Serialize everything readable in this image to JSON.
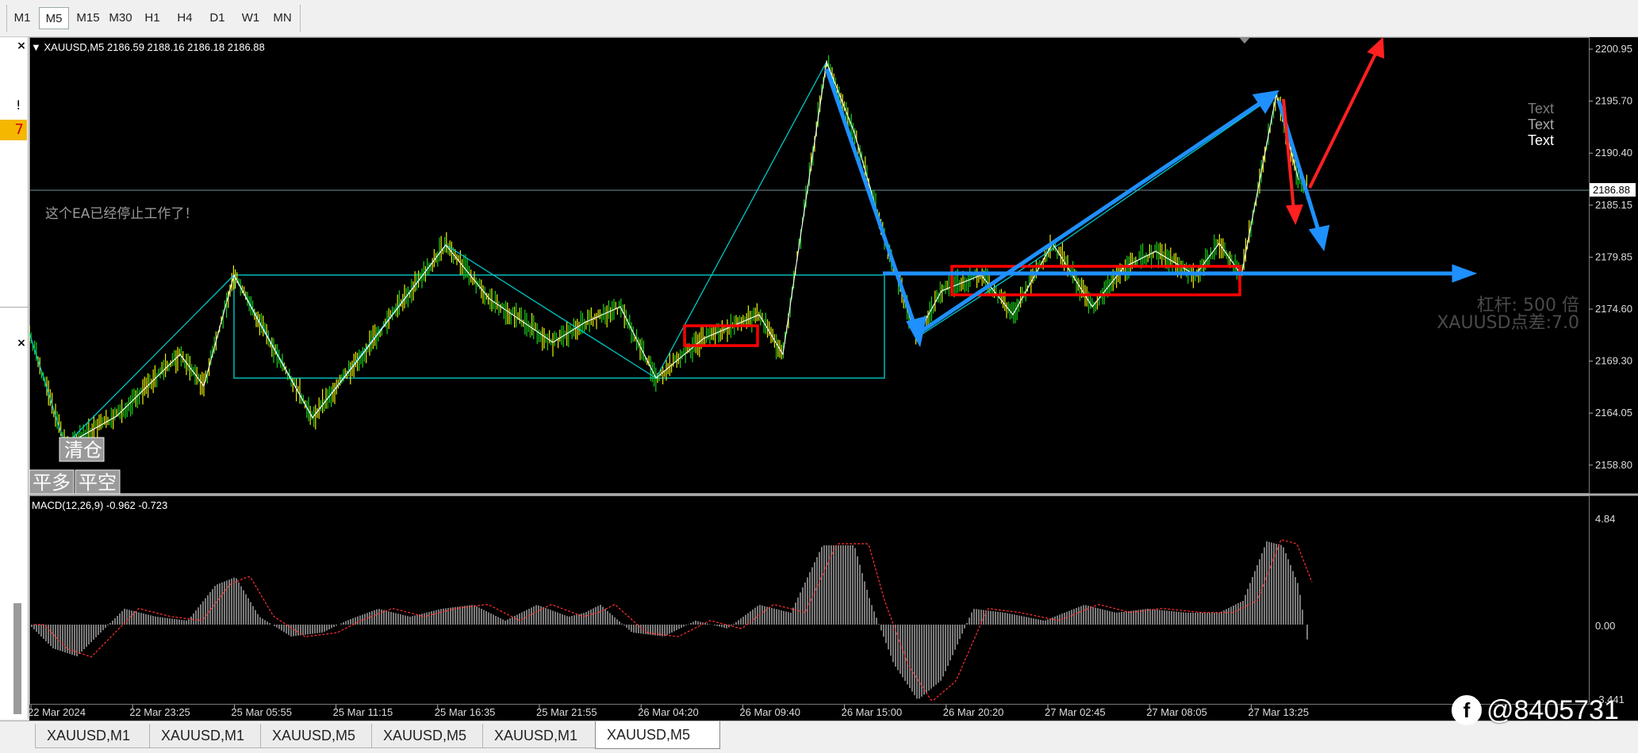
{
  "toolbar": {
    "timeframes": [
      "M1",
      "M5",
      "M15",
      "M30",
      "H1",
      "H4",
      "D1",
      "W1",
      "MN"
    ],
    "active": "M5"
  },
  "left_panel": {
    "close1": "×",
    "close2": "×",
    "excl": "!",
    "badge": "7"
  },
  "chart": {
    "header": "▼ XAUUSD,M5  2186.59 2188.16 2186.18 2186.88",
    "ea_message": "这个EA已经停止工作了！",
    "side_labels": [
      "Text",
      "Text",
      "Text"
    ],
    "leverage": "杠杆: 500 倍",
    "spread": "XAUUSD点差:7.0",
    "btn_close_all": "清仓",
    "btn_close_long": "平多",
    "btn_close_short": "平空",
    "current_price": "2186.88",
    "price_ticks": [
      "2200.95",
      "2195.70",
      "2190.40",
      "2185.15",
      "2179.85",
      "2174.60",
      "2169.30",
      "2164.05",
      "2158.80"
    ],
    "macd_label": "MACD(12,26,9) -0.962 -0.723",
    "macd_ticks": [
      "4.84",
      "0.00",
      "-3.441"
    ],
    "time_labels": [
      "22 Mar 2024",
      "22 Mar 23:25",
      "25 Mar 05:55",
      "25 Mar 11:15",
      "25 Mar 16:35",
      "25 Mar 21:55",
      "26 Mar 04:20",
      "26 Mar 09:40",
      "26 Mar 15:00",
      "26 Mar 20:20",
      "27 Mar 02:45",
      "27 Mar 08:05",
      "27 Mar 13:25"
    ],
    "colors": {
      "candle": "#19d019",
      "zigzag": "#00c8c8",
      "arrow_blue": "#1e90ff",
      "arrow_red": "#ff2020",
      "box_red": "#ff0000",
      "signal": "#ff3030"
    }
  },
  "tabs": [
    "XAUUSD,M1",
    "XAUUSD,M1",
    "XAUUSD,M5",
    "XAUUSD,M5",
    "XAUUSD,M1",
    "XAUUSD,M5"
  ],
  "active_tab": 5,
  "watermark": "@8405731"
}
